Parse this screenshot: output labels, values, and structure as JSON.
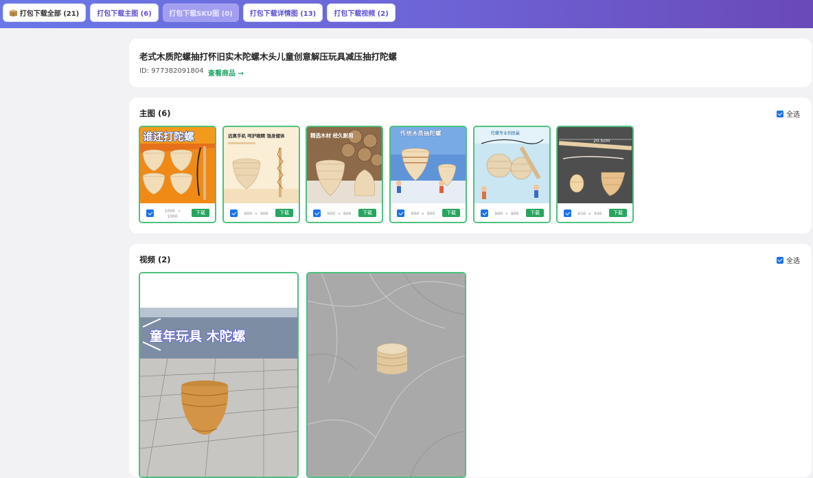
{
  "toolbar": {
    "buttons": [
      {
        "label": "打包下载全部 (21)",
        "icon": "package-icon"
      },
      {
        "label": "打包下载主图 (6)"
      },
      {
        "label": "打包下载SKU图 (0)",
        "disabled": true
      },
      {
        "label": "打包下载详情图 (13)"
      },
      {
        "label": "打包下载视频 (2)"
      }
    ],
    "gradient_start": "#6a78e6",
    "gradient_end": "#6a49b8"
  },
  "product": {
    "title": "老式木质陀螺抽打怀旧实木陀螺木头儿童创意解压玩具减压抽打陀螺",
    "id_text": "ID: 977382091804",
    "view_link": "查看商品 →"
  },
  "main_images": {
    "title": "主图 (6)",
    "select_all": "全选",
    "items": [
      {
        "dims": "1000 × 1000",
        "download": "下载",
        "caption": "谁还打陀螺",
        "checked": true
      },
      {
        "dims": "800 × 800",
        "download": "下载",
        "caption": "远离手机 呵护眼睛 强身健体",
        "checked": true
      },
      {
        "dims": "800 × 800",
        "download": "下载",
        "caption": "精选木材 经久耐用",
        "checked": true
      },
      {
        "dims": "800 × 800",
        "download": "下载",
        "caption": "传统木质抽陀螺",
        "checked": true
      },
      {
        "dims": "800 × 800",
        "download": "下载",
        "caption": "陀螺专业到底最",
        "checked": true
      },
      {
        "dims": "636 × 446",
        "download": "下载",
        "caption": "20.5cm",
        "checked": true
      }
    ]
  },
  "videos": {
    "title": "视频 (2)",
    "select_all": "全选",
    "items": [
      {
        "overlay": "童年玩具 木陀螺"
      },
      {
        "overlay": ""
      }
    ]
  },
  "colors": {
    "accent_green": "#27a55f",
    "tile_border": "#4cc17e",
    "checkbox_blue": "#1a73e8",
    "link_green": "#1aa563"
  }
}
